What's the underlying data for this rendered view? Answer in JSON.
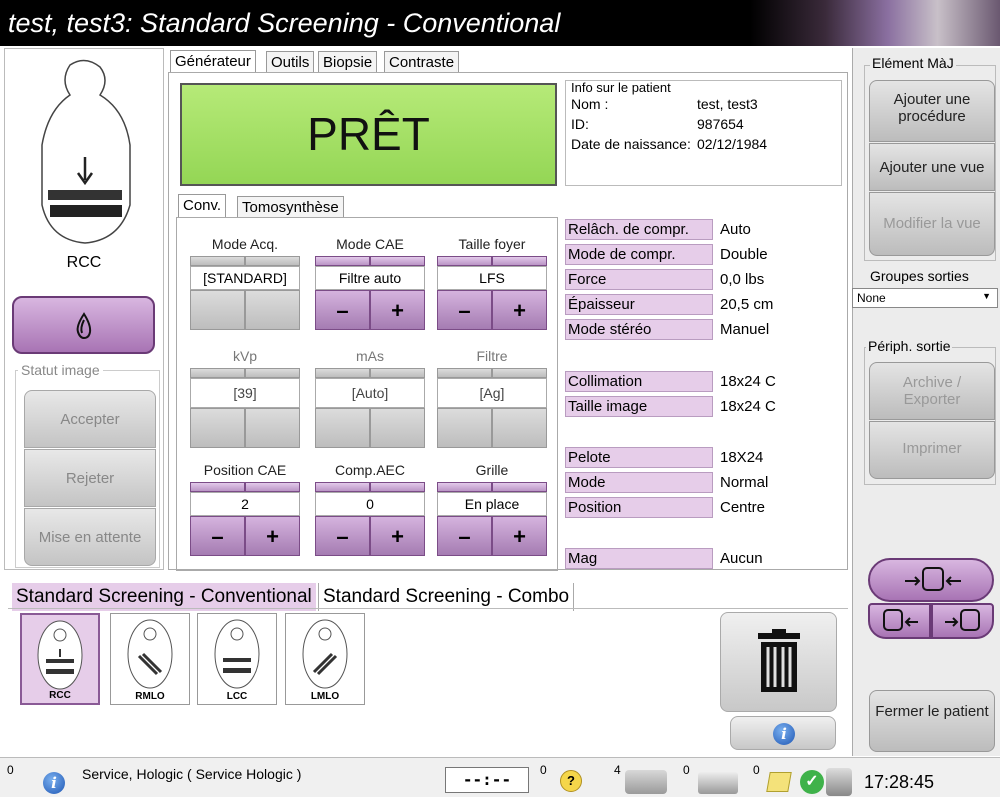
{
  "window": {
    "title": "test, test3:  Standard Screening - Conventional"
  },
  "left": {
    "view_label": "RCC",
    "statut_image": "Statut image",
    "accepter": "Accepter",
    "rejeter": "Rejeter",
    "attente": "Mise en attente"
  },
  "tabs": [
    "Générateur",
    "Outils",
    "Biopsie",
    "Contraste"
  ],
  "ready": "PRÊT",
  "patient": {
    "header": "Info sur le patient",
    "nom_label": "Nom :",
    "nom": "test, test3",
    "id_label": "ID:",
    "id": "987654",
    "dob_label": "Date de naissance:",
    "dob": "02/12/1984"
  },
  "subtabs": [
    "Conv.",
    "Tomosynthèse"
  ],
  "controls": {
    "mode_acq": {
      "label": "Mode Acq.",
      "value": "[STANDARD]"
    },
    "mode_cae": {
      "label": "Mode CAE",
      "value": "Filtre auto"
    },
    "taille_foyer": {
      "label": "Taille foyer",
      "value": "LFS"
    },
    "kvp": {
      "label": "kVp",
      "value": "[39]"
    },
    "mas": {
      "label": "mAs",
      "value": "[Auto]"
    },
    "filtre": {
      "label": "Filtre",
      "value": "[Ag]"
    },
    "position_cae": {
      "label": "Position CAE",
      "value": "2"
    },
    "comp_aec": {
      "label": "Comp.AEC",
      "value": "0"
    },
    "grille": {
      "label": "Grille",
      "value": "En place"
    },
    "minus": "–",
    "plus": "+"
  },
  "params": [
    {
      "label": "Relâch. de compr.",
      "value": "Auto"
    },
    {
      "label": "Mode de compr.",
      "value": "Double"
    },
    {
      "label": "Force",
      "value": "0,0 lbs"
    },
    {
      "label": "Épaisseur",
      "value": "20,5 cm"
    },
    {
      "label": "Mode stéréo",
      "value": "Manuel"
    },
    {
      "label": "Collimation",
      "value": "18x24 C"
    },
    {
      "label": "Taille image",
      "value": "18x24 C"
    },
    {
      "label": "Pelote",
      "value": "18X24"
    },
    {
      "label": "Mode",
      "value": "Normal"
    },
    {
      "label": "Position",
      "value": "Centre"
    },
    {
      "label": "Mag",
      "value": "Aucun"
    }
  ],
  "right": {
    "element_maj": "Elément MàJ",
    "ajouter_procedure": "Ajouter une procédure",
    "ajouter_vue": "Ajouter une vue",
    "modifier_vue": "Modifier la vue",
    "groupes_sorties": "Groupes sorties",
    "groupes_value": "None",
    "periph_sortie": "Périph. sortie",
    "archive": "Archive / Exporter",
    "imprimer": "Imprimer",
    "fermer": "Fermer le patient"
  },
  "seq_tabs": [
    "Standard Screening - Conventional",
    "Standard Screening - Combo"
  ],
  "thumbs": [
    "RCC",
    "RMLO",
    "LCC",
    "LMLO"
  ],
  "status": {
    "count0": "0",
    "user": "Service, Hologic ( Service Hologic )",
    "timer": "--:--",
    "c1": "0",
    "c2": "4",
    "c3": "0",
    "c4": "0",
    "time": "17:28:45"
  },
  "colors": {
    "ready": "#a8e26a",
    "accent": "#b98ac4",
    "param_bg": "#e6cde9"
  }
}
